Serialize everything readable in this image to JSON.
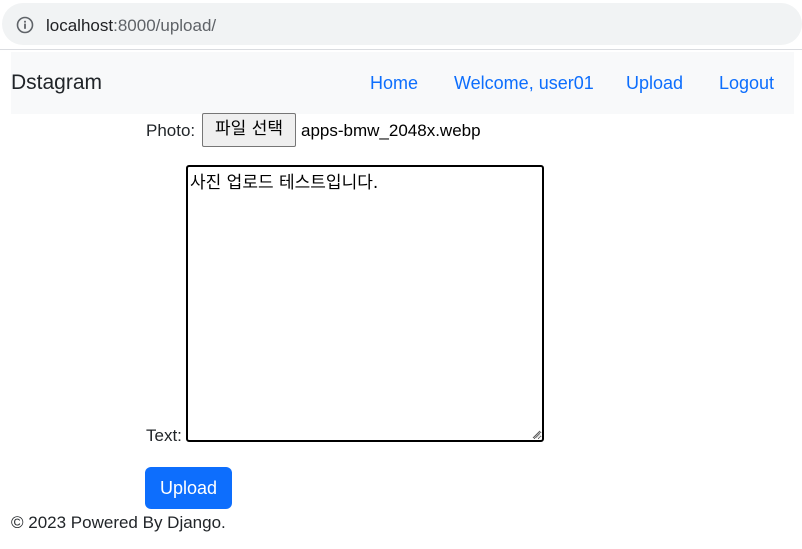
{
  "browser": {
    "url_host": "localhost",
    "url_path": ":8000/upload/"
  },
  "navbar": {
    "brand": "Dstagram",
    "links": [
      "Home",
      "Welcome, user01",
      "Upload",
      "Logout"
    ]
  },
  "form": {
    "photo_label": "Photo:",
    "file_button_label": "파일 선택",
    "file_name": "apps-bmw_2048x.webp",
    "text_label": "Text:",
    "text_value": "사진 업로드 테스트입니다.",
    "submit_label": "Upload"
  },
  "footer": {
    "text": "© 2023 Powered By Django."
  },
  "colors": {
    "accent": "#0d6efd",
    "navbar_bg": "#f8f9fa",
    "address_bar_bg": "#f1f3f4"
  }
}
